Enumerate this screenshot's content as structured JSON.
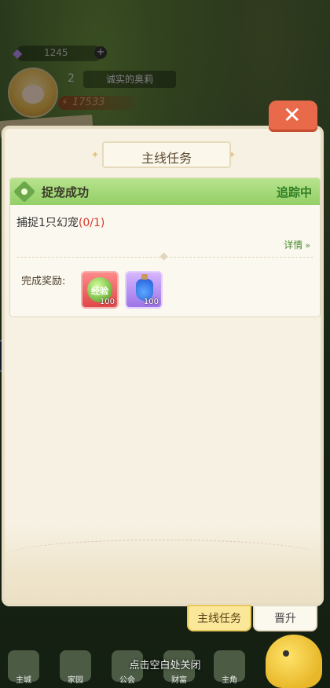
{
  "hud": {
    "gems": "1245",
    "plus": "+",
    "level": "2",
    "player_name": "诚实的奥莉",
    "power": "17533"
  },
  "panel": {
    "title": "主线任务",
    "close_icon": "✕",
    "task": {
      "name": "捉宠成功",
      "status": "追踪中",
      "goal_text": "捕捉1只幻宠",
      "goal_progress": "(0/1)",
      "detail_label": "详情",
      "reward_label": "完成奖励:",
      "rewards": [
        {
          "icon": "exp-orb-icon",
          "label": "经验",
          "count": "100"
        },
        {
          "icon": "blue-potion-icon",
          "count": "100"
        }
      ]
    }
  },
  "tabs": {
    "main": "主线任务",
    "promotion": "晋升"
  },
  "hint": "点击空白处关闭",
  "nav": [
    "主城",
    "家园",
    "公会",
    "财富",
    "主角"
  ],
  "colors": {
    "accent_green": "#93cf67",
    "close_red": "#e96a4a",
    "progress_red": "#d63a2c"
  }
}
